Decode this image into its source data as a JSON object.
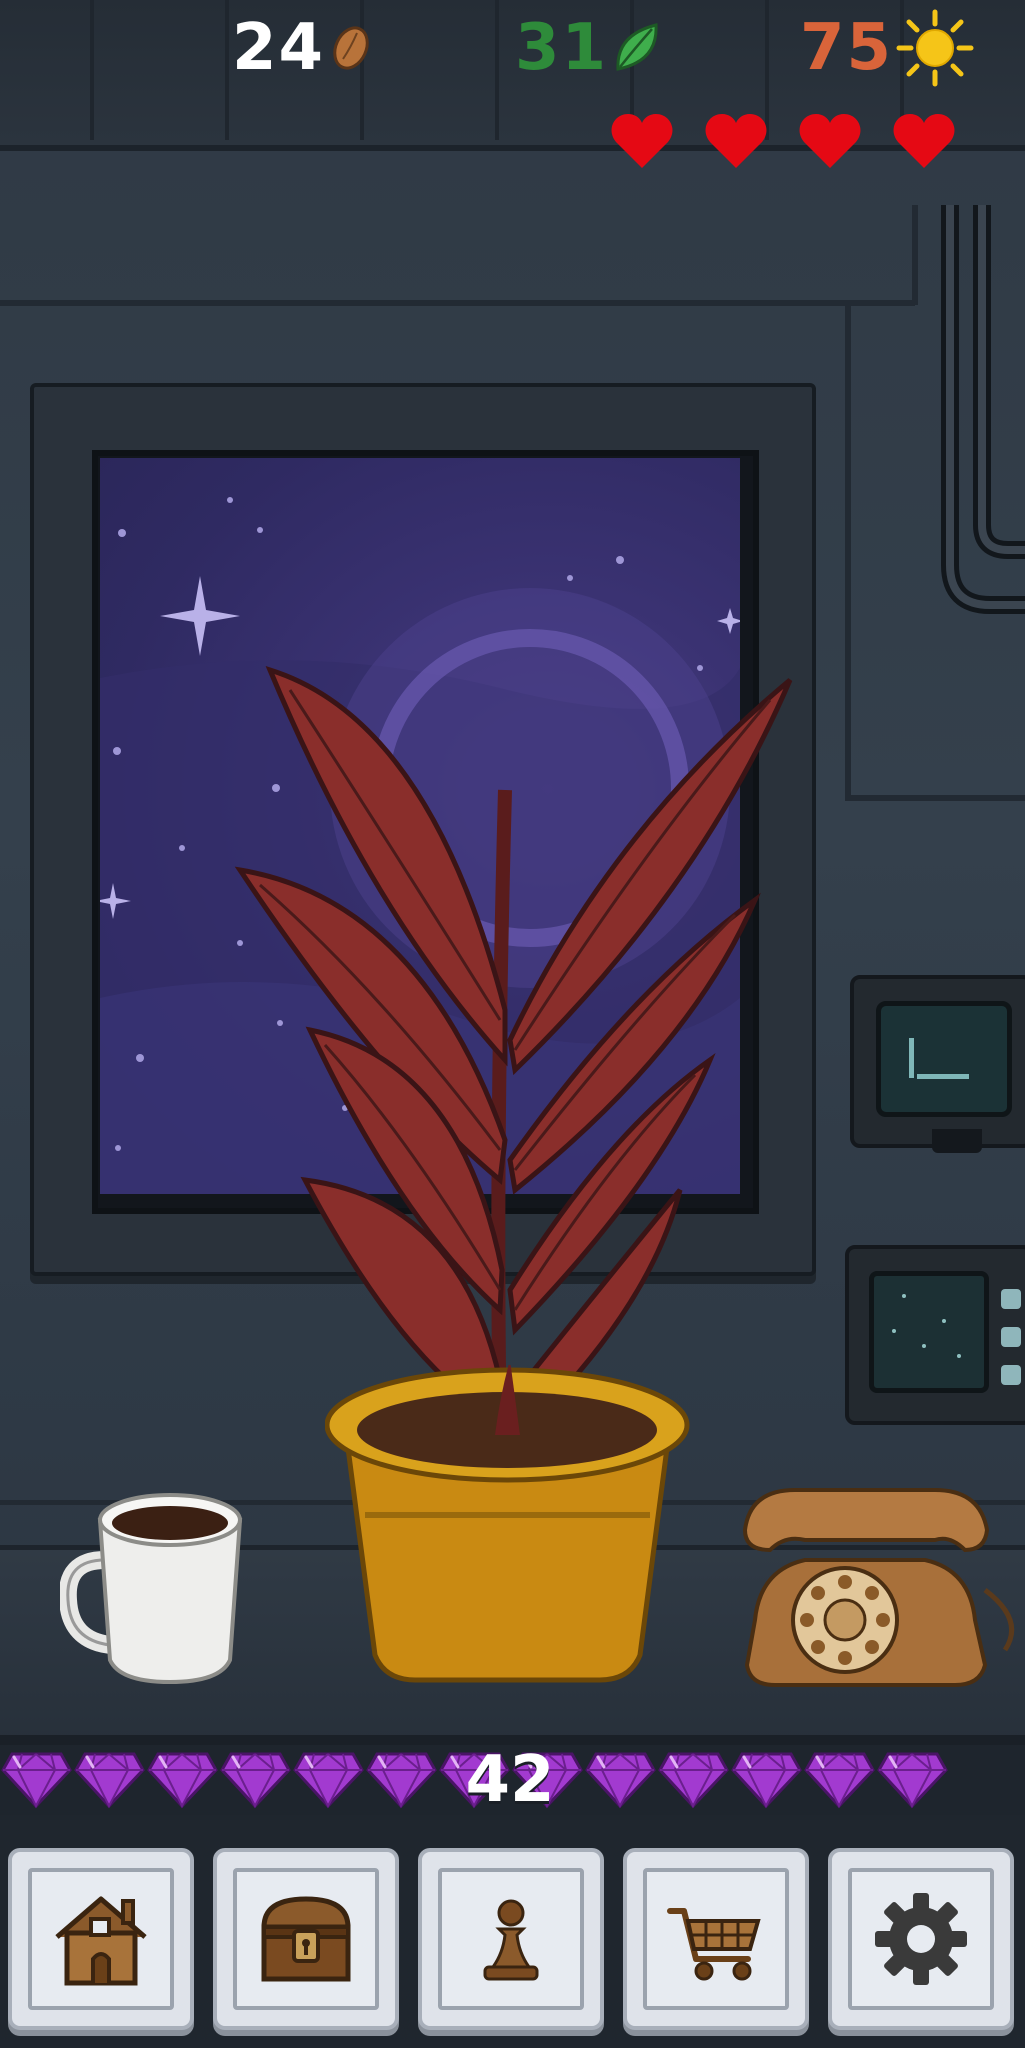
{
  "resources": {
    "seeds": {
      "value": "24",
      "color": "#ffffff",
      "icon": "seed-icon"
    },
    "leaves": {
      "value": "31",
      "color": "#2e8b3a",
      "icon": "leaf-icon"
    },
    "sun": {
      "value": "75",
      "color": "#d9643a",
      "icon": "sun-icon"
    }
  },
  "lives": {
    "hearts": 4,
    "color": "#e50914"
  },
  "gems": {
    "count": "42",
    "color": "#a23ad0",
    "icon": "gem-icon"
  },
  "nav": [
    {
      "id": "home",
      "icon": "house-icon"
    },
    {
      "id": "inventory",
      "icon": "chest-icon"
    },
    {
      "id": "character",
      "icon": "pawn-icon"
    },
    {
      "id": "shop",
      "icon": "cart-icon"
    },
    {
      "id": "settings",
      "icon": "gear-icon"
    }
  ],
  "scene": {
    "items": [
      "window-space-view",
      "red-leaf-plant",
      "coffee-mug",
      "rotary-telephone",
      "wall-monitor",
      "wall-radar-panel"
    ]
  }
}
